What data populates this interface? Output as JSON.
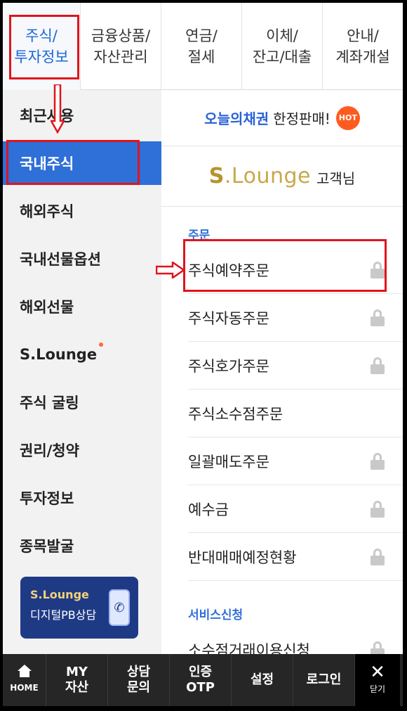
{
  "top_tabs": [
    {
      "line1": "주식/",
      "line2": "투자정보"
    },
    {
      "line1": "금융상품/",
      "line2": "자산관리"
    },
    {
      "line1": "연금/",
      "line2": "절세"
    },
    {
      "line1": "이체/",
      "line2": "잔고/대출"
    },
    {
      "line1": "안내/",
      "line2": "계좌개설"
    }
  ],
  "sidebar": {
    "items": [
      {
        "label": "최근사용"
      },
      {
        "label": "국내주식"
      },
      {
        "label": "해외주식"
      },
      {
        "label": "국내선물옵션"
      },
      {
        "label": "해외선물"
      },
      {
        "label": "S.Lounge"
      },
      {
        "label": "주식 굴링"
      },
      {
        "label": "권리/청약"
      },
      {
        "label": "투자정보"
      },
      {
        "label": "종목발굴"
      }
    ],
    "pb_banner": {
      "title": "S.Lounge",
      "subtitle": "디지털PB상담"
    }
  },
  "promo": {
    "highlight": "오늘의채권",
    "text": "한정판매!",
    "badge": "HOT"
  },
  "slounge": {
    "logo_s": "S",
    "logo_rest": ".Lounge",
    "suffix": "고객님"
  },
  "sections": {
    "order_title": "주문",
    "order_items": [
      {
        "label": "주식예약주문"
      },
      {
        "label": "주식자동주문"
      },
      {
        "label": "주식호가주문"
      },
      {
        "label": "주식소수점주문"
      },
      {
        "label": "일괄매도주문"
      },
      {
        "label": "예수금"
      },
      {
        "label": "반대매매예정현황"
      }
    ],
    "service_title": "서비스신청",
    "service_items": [
      {
        "label": "소수점거래이용신청"
      }
    ]
  },
  "bottom_bar": {
    "home": "HOME",
    "items": [
      {
        "line1": "MY",
        "line2": "자산"
      },
      {
        "line1": "상담",
        "line2": "문의"
      },
      {
        "line1": "인증",
        "line2": "OTP"
      },
      {
        "line1": "설정",
        "line2": ""
      },
      {
        "line1": "로그인",
        "line2": ""
      }
    ],
    "close_label": "닫기"
  },
  "colors": {
    "accent": "#2e6fd8",
    "annotation": "#e0141c",
    "bottom_bar": "#262626"
  }
}
